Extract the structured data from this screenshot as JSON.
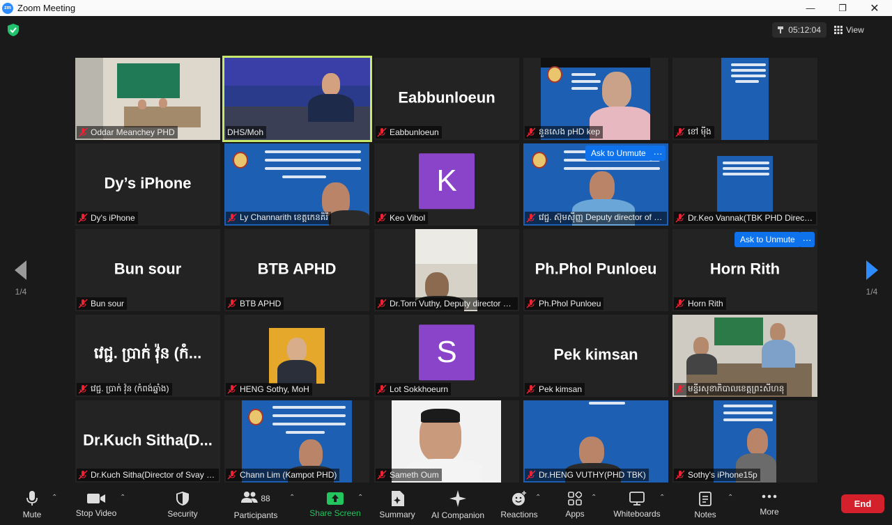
{
  "window": {
    "title": "Zoom Meeting",
    "logo_text": "zm"
  },
  "topbar": {
    "timer": "05:12:04",
    "view_label": "View"
  },
  "pagination": {
    "left_page": "1/4",
    "right_page": "1/4"
  },
  "tiles": [
    {
      "label": "Oddar Meanchey PHD"
    },
    {
      "label": "DHS/Moh"
    },
    {
      "label": "Eabbunloeun",
      "bigname": "Eabbunloeun"
    },
    {
      "label": "នួនសេង pHD kep"
    },
    {
      "label": "ខៅ មុីង"
    },
    {
      "label": "Dy's iPhone",
      "bigname": "Dy’s iPhone"
    },
    {
      "label": "Ly Channarith ខេត្តកេនគិរី"
    },
    {
      "label": "Keo Vibol",
      "avatar": "K"
    },
    {
      "label": "វេជ្ជ. ស៊ុមស៊ីញ្ញ Deputy director of Kep PHD"
    },
    {
      "label": "Dr.Keo Vannak(TBK PHD Director)"
    },
    {
      "label": "Bun sour",
      "bigname": "Bun sour"
    },
    {
      "label": "BTB APHD",
      "bigname": "BTB APHD"
    },
    {
      "label": "Dr.Torn Vuthy, Deputy director PHD"
    },
    {
      "label": "Ph.Phol Punloeu",
      "bigname": "Ph.Phol Punloeu"
    },
    {
      "label": "Horn Rith",
      "bigname": "Horn Rith"
    },
    {
      "label": "វេជ្ជ. ប្រាក់ វ៉ុន (កំពង់ឆ្នាំង)",
      "bigname": "វេជ្ជ. ប្រាក់ វ៉ុន (កំ..."
    },
    {
      "label": "HENG Sothy, MoH"
    },
    {
      "label": "Lot Sokkhoeurn",
      "avatar": "S"
    },
    {
      "label": "Pek kimsan",
      "bigname": "Pek kimsan"
    },
    {
      "label": "មន្ទីរសុខាភិបាលខេត្តព្រះសីហនុ"
    },
    {
      "label": "Dr.Kuch Sitha(Director of Svay Rieng PHD)",
      "bigname": "Dr.Kuch Sitha(D..."
    },
    {
      "label": "Chann Lim (Kampot PHD)"
    },
    {
      "label": "Sameth Oum"
    },
    {
      "label": "Dr.HENG VUTHY(PHD TBK)"
    },
    {
      "label": "Sothy's iPhone15p"
    }
  ],
  "overlays": {
    "ask_unmute_label": "Ask to Unmute",
    "more_label": "···"
  },
  "toolbar": {
    "mute": "Mute",
    "stop_video": "Stop Video",
    "security": "Security",
    "participants": "Participants",
    "participants_count": "88",
    "share_screen": "Share Screen",
    "summary": "Summary",
    "ai_companion": "AI Companion",
    "reactions": "Reactions",
    "apps": "Apps",
    "whiteboards": "Whiteboards",
    "notes": "Notes",
    "more": "More",
    "end": "End"
  },
  "colors": {
    "accent": "#0e72ed",
    "active_speaker": "#c7e86b",
    "share_green": "#22c55e",
    "end_red": "#d4202a",
    "avatar_purple": "#8a44c9"
  }
}
